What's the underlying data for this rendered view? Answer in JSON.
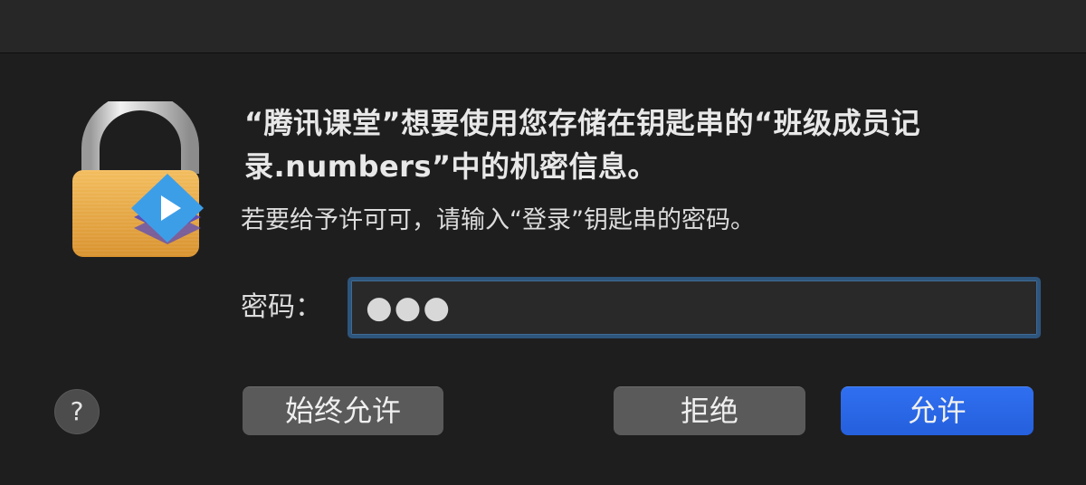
{
  "dialog": {
    "message": "“腾讯课堂”想要使用您存储在钥匙串的“班级成员记录.numbers”中的机密信息。",
    "submessage": "若要给予许可可，请输入“登录”钥匙串的密码。",
    "password_label": "密码：",
    "password_value": "●●●",
    "icon": "lock-with-app-badge-icon",
    "help_label": "?"
  },
  "buttons": {
    "always_allow": "始终允许",
    "deny": "拒绝",
    "allow": "允许"
  },
  "colors": {
    "background": "#1f1e1f",
    "primary_button": "#2a67e8",
    "secondary_button": "#5b5a5b",
    "focus_ring": "#2e557c",
    "lock_gold": "#e9a94a",
    "badge_blue": "#3d9ee8"
  }
}
